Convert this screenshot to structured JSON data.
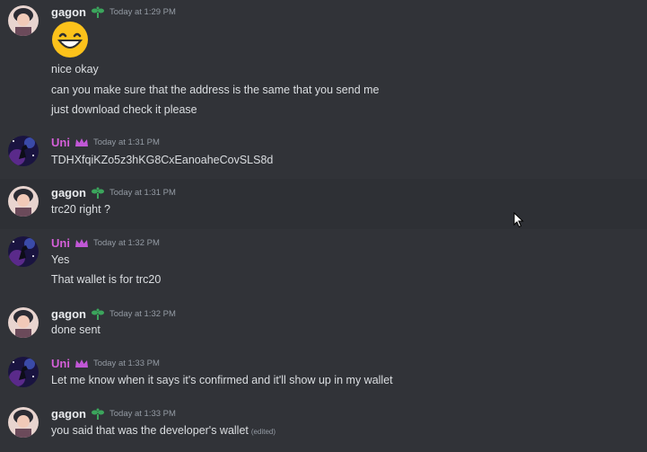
{
  "colors": {
    "background": "#313338",
    "text": "#dbdee1",
    "timestamp": "#949ba4",
    "gagon_name": "#e8eaed",
    "uni_name": "#d45fd8",
    "gagon_badge": "#3ba55c",
    "uni_badge": "#c157d6"
  },
  "messages": [
    {
      "author": "gagon",
      "badge_icon": "sprout-icon",
      "timestamp": "Today at 1:29 PM",
      "emoji": "grinning-face-emoji",
      "lines": [
        "nice okay",
        "can you make sure that the address is the same that you send me",
        "just download check it please"
      ]
    },
    {
      "author": "Uni",
      "badge_icon": "crown-icon",
      "timestamp": "Today at 1:31 PM",
      "lines": [
        "TDHXfqiKZo5z3hKG8CxEanoaheCovSLS8d"
      ]
    },
    {
      "author": "gagon",
      "badge_icon": "sprout-icon",
      "timestamp": "Today at 1:31 PM",
      "lines": [
        "trc20 right ?"
      ]
    },
    {
      "author": "Uni",
      "badge_icon": "crown-icon",
      "timestamp": "Today at 1:32 PM",
      "lines": [
        "Yes",
        "That wallet is for trc20"
      ]
    },
    {
      "author": "gagon",
      "badge_icon": "sprout-icon",
      "timestamp": "Today at 1:32 PM",
      "lines": [
        "done sent"
      ]
    },
    {
      "author": "Uni",
      "badge_icon": "crown-icon",
      "timestamp": "Today at 1:33 PM",
      "lines": [
        "Let me know when it says it's confirmed and it'll show up in my wallet"
      ]
    },
    {
      "author": "gagon",
      "badge_icon": "sprout-icon",
      "timestamp": "Today at 1:33 PM",
      "lines": [
        "you said that was the developer's wallet"
      ],
      "edited": "(edited)"
    }
  ]
}
